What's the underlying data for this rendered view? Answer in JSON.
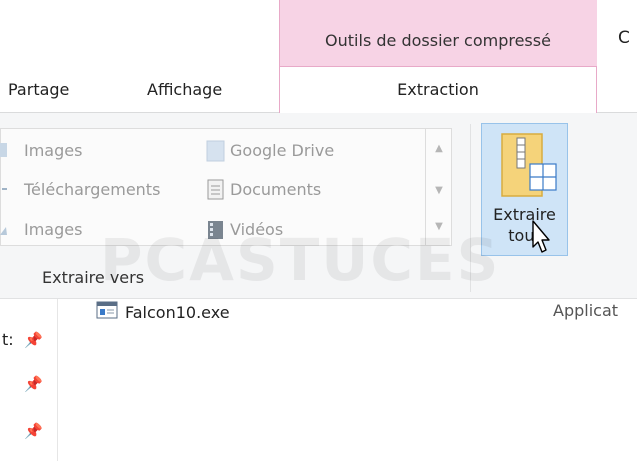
{
  "ribbon": {
    "context_title": "Outils de dossier compressé",
    "title_fragment": "C",
    "tabs": [
      {
        "label": "Partage"
      },
      {
        "label": "Affichage"
      },
      {
        "label": "Extraction"
      }
    ],
    "gallery": {
      "items": [
        {
          "label": "Images",
          "icon": "images-folder-icon"
        },
        {
          "label": "Téléchargements",
          "icon": "downloads-folder-icon"
        },
        {
          "label": "Images",
          "icon": "images-folder-icon"
        },
        {
          "label": "Google Drive",
          "icon": "google-drive-folder-icon"
        },
        {
          "label": "Documents",
          "icon": "documents-folder-icon"
        },
        {
          "label": "Vidéos",
          "icon": "videos-folder-icon"
        }
      ],
      "scroll": {
        "up": "▲",
        "down": "▼",
        "more": "▼"
      }
    },
    "group_label": "Extraire vers",
    "extract_all": {
      "label_line1": "Extraire",
      "label_line2": "tout"
    }
  },
  "watermark": "PCASTUCES",
  "files": {
    "nav_fragment": "t:",
    "rows": [
      {
        "name": "Falcon10.exe",
        "type_fragment": "Applicat"
      }
    ],
    "pin_glyph": "📌"
  },
  "colors": {
    "context_tab": "#f7d3e5",
    "context_border": "#e8a9c8",
    "selected_button": "#cfe4f7",
    "ribbon_bg": "#f5f6f7"
  }
}
